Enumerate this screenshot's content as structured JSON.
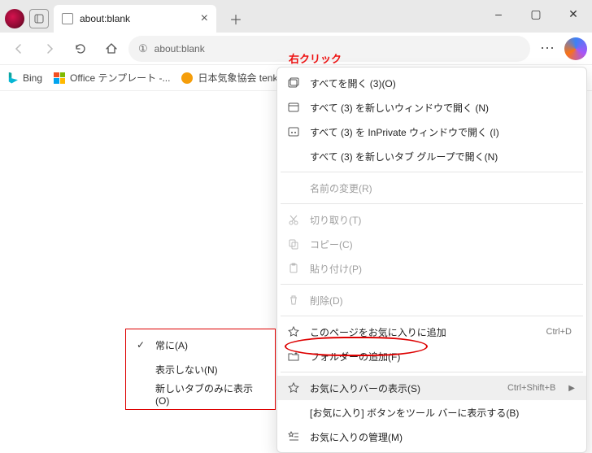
{
  "titleBar": {
    "tabTitle": "about:blank",
    "closeGlyph": "×",
    "newTabGlyph": "＋",
    "minGlyph": "–",
    "maxGlyph": "▢",
    "winCloseGlyph": "✕"
  },
  "toolbar": {
    "addressIcon": "①",
    "addressText": "about:blank",
    "moreGlyph": "⋯"
  },
  "favBar": {
    "items": [
      {
        "label": "Bing",
        "icon": "bing"
      },
      {
        "label": "Office テンプレート -...",
        "icon": "office"
      },
      {
        "label": "日本気象協会 tenki.j...",
        "icon": "tenki"
      }
    ]
  },
  "annotation": "右クリック",
  "context": {
    "items": [
      {
        "icon": "openall",
        "label": "すべてを開く (3)(O)"
      },
      {
        "icon": "window",
        "label": "すべて (3) を新しいウィンドウで開く (N)"
      },
      {
        "icon": "inprivate",
        "label": "すべて (3) を InPrivate ウィンドウで開く (I)"
      },
      {
        "icon": "",
        "label": "すべて (3) を新しいタブ グループで開く(N)"
      }
    ],
    "rename": {
      "label": "名前の変更(R)",
      "disabled": true
    },
    "edit": [
      {
        "icon": "cut",
        "label": "切り取り(T)",
        "disabled": true
      },
      {
        "icon": "copy",
        "label": "コピー(C)",
        "disabled": true
      },
      {
        "icon": "paste",
        "label": "貼り付け(P)",
        "disabled": true
      }
    ],
    "delete": {
      "icon": "trash",
      "label": "削除(D)",
      "disabled": true
    },
    "fav": [
      {
        "icon": "star",
        "label": "このページをお気に入りに追加",
        "accel": "Ctrl+D"
      },
      {
        "icon": "folder",
        "label": "フォルダーの追加(F)"
      }
    ],
    "show": {
      "icon": "star",
      "label": "お気に入りバーの表示(S)",
      "accel": "Ctrl+Shift+B",
      "sub": true,
      "hover": true
    },
    "tail": [
      {
        "icon": "",
        "label": "[お気に入り] ボタンをツール バーに表示する(B)"
      },
      {
        "icon": "starlines",
        "label": "お気に入りの管理(M)"
      }
    ]
  },
  "submenu": {
    "items": [
      {
        "checked": true,
        "label": "常に(A)"
      },
      {
        "checked": false,
        "label": "表示しない(N)"
      },
      {
        "checked": false,
        "label": "新しいタブのみに表示(O)"
      }
    ]
  }
}
